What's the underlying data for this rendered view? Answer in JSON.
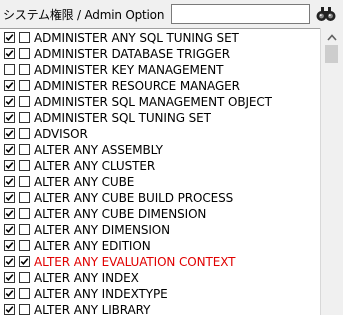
{
  "header": {
    "label": "システム権限 / Admin Option",
    "search_value": "",
    "find_icon": "binoculars-icon"
  },
  "list": {
    "items": [
      {
        "label": "ADMINISTER ANY SQL TUNING SET",
        "granted": true,
        "admin_option": false,
        "highlight": false
      },
      {
        "label": "ADMINISTER DATABASE TRIGGER",
        "granted": true,
        "admin_option": false,
        "highlight": false
      },
      {
        "label": "ADMINISTER KEY MANAGEMENT",
        "granted": false,
        "admin_option": false,
        "highlight": false
      },
      {
        "label": "ADMINISTER RESOURCE MANAGER",
        "granted": true,
        "admin_option": false,
        "highlight": false
      },
      {
        "label": "ADMINISTER SQL MANAGEMENT OBJECT",
        "granted": true,
        "admin_option": false,
        "highlight": false
      },
      {
        "label": "ADMINISTER SQL TUNING SET",
        "granted": true,
        "admin_option": false,
        "highlight": false
      },
      {
        "label": "ADVISOR",
        "granted": true,
        "admin_option": false,
        "highlight": false
      },
      {
        "label": "ALTER ANY ASSEMBLY",
        "granted": true,
        "admin_option": false,
        "highlight": false
      },
      {
        "label": "ALTER ANY CLUSTER",
        "granted": true,
        "admin_option": false,
        "highlight": false
      },
      {
        "label": "ALTER ANY CUBE",
        "granted": true,
        "admin_option": false,
        "highlight": false
      },
      {
        "label": "ALTER ANY CUBE BUILD PROCESS",
        "granted": true,
        "admin_option": false,
        "highlight": false
      },
      {
        "label": "ALTER ANY CUBE DIMENSION",
        "granted": true,
        "admin_option": false,
        "highlight": false
      },
      {
        "label": "ALTER ANY DIMENSION",
        "granted": true,
        "admin_option": false,
        "highlight": false
      },
      {
        "label": "ALTER ANY EDITION",
        "granted": true,
        "admin_option": false,
        "highlight": false
      },
      {
        "label": "ALTER ANY EVALUATION CONTEXT",
        "granted": true,
        "admin_option": true,
        "highlight": true
      },
      {
        "label": "ALTER ANY INDEX",
        "granted": true,
        "admin_option": false,
        "highlight": false
      },
      {
        "label": "ALTER ANY INDEXTYPE",
        "granted": true,
        "admin_option": false,
        "highlight": false
      },
      {
        "label": "ALTER ANY LIBRARY",
        "granted": true,
        "admin_option": false,
        "highlight": false
      }
    ]
  },
  "colors": {
    "highlight_text": "#e00000",
    "window_bg": "#f0f0f0",
    "list_bg": "#ffffff"
  }
}
